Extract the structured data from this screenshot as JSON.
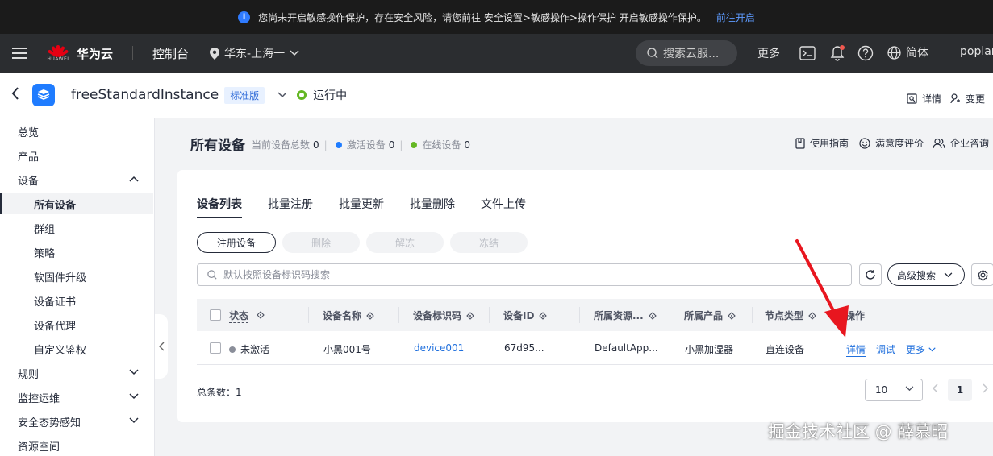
{
  "banner": {
    "message": "您尚未开启敏感操作保护，存在安全风险，请您前往 安全设置>敏感操作>操作保护 开启敏感操作保护。",
    "link": "前往开启"
  },
  "topnav": {
    "logo_small": "HUAWEI",
    "brand": "华为云",
    "console": "控制台",
    "region": "华东-上海一",
    "search_placeholder": "搜索云服...",
    "more": "更多",
    "lang": "简体",
    "user": "poplar"
  },
  "instance": {
    "name": "freeStandardInstance",
    "edition": "标准版",
    "status": "运行中",
    "status_color": "#64b723",
    "details": "详情",
    "change": "变更"
  },
  "sidebar": {
    "items": [
      {
        "label": "总览"
      },
      {
        "label": "产品"
      },
      {
        "label": "设备"
      },
      {
        "label": "所有设备"
      },
      {
        "label": "群组"
      },
      {
        "label": "策略"
      },
      {
        "label": "软固件升级"
      },
      {
        "label": "设备证书"
      },
      {
        "label": "设备代理"
      },
      {
        "label": "自定义鉴权"
      },
      {
        "label": "规则"
      },
      {
        "label": "监控运维"
      },
      {
        "label": "安全态势感知"
      },
      {
        "label": "资源空间"
      }
    ]
  },
  "main": {
    "title": "所有设备",
    "stats": {
      "total_label": "当前设备总数",
      "total": "0",
      "active_label": "激活设备",
      "active": "0",
      "online_label": "在线设备",
      "online": "0",
      "active_color": "#1f7cff",
      "online_color": "#64b723"
    },
    "actions": {
      "guide": "使用指南",
      "rating": "满意度评价",
      "consult": "企业咨询"
    },
    "tabs": [
      {
        "label": "设备列表"
      },
      {
        "label": "批量注册"
      },
      {
        "label": "批量更新"
      },
      {
        "label": "批量删除"
      },
      {
        "label": "文件上传"
      }
    ],
    "buttons": {
      "register": "注册设备",
      "delete": "删除",
      "unfreeze": "解冻",
      "freeze": "冻结"
    },
    "search_placeholder": "默认按照设备标识码搜索",
    "advanced_search": "高级搜索",
    "table": {
      "headers": [
        "状态",
        "设备名称",
        "设备标识码",
        "设备ID",
        "所属资源...",
        "所属产品",
        "节点类型",
        "操作"
      ],
      "rows": [
        {
          "status": "未激活",
          "name": "小黑001号",
          "identifier": "device001",
          "device_id": "67d95...",
          "resource": "DefaultApp...",
          "product": "小黑加湿器",
          "node_type": "直连设备",
          "op_detail": "详情",
          "op_debug": "调试",
          "op_more": "更多"
        }
      ]
    },
    "total_label": "总条数：1",
    "page_size": "10",
    "current_page": "1"
  },
  "watermark": "掘金技术社区 @ 薛慕昭"
}
